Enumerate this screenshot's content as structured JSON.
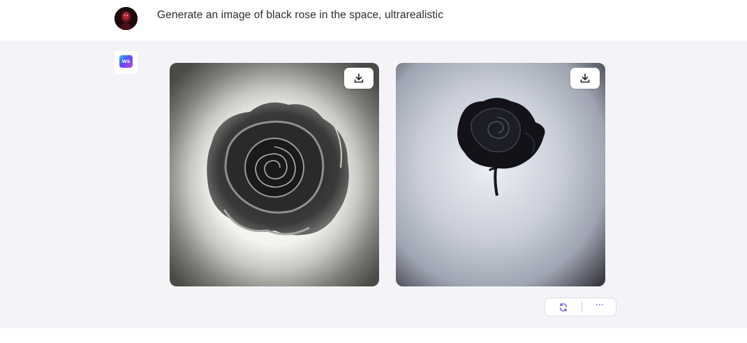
{
  "conversation": {
    "user_message": {
      "text": "Generate an image of black rose in the space, ultrarealistic",
      "avatar_icon": "user-avatar-icon"
    },
    "assistant": {
      "logo_text": "WS",
      "logo_colors": [
        "#25c4f7",
        "#5a4cf5",
        "#c341e6"
      ],
      "images": [
        {
          "subject": "black rose, bright halo background",
          "download_icon": "download-icon"
        },
        {
          "subject": "black rose with stem, gray-blue background",
          "download_icon": "download-icon"
        }
      ],
      "actions": {
        "regenerate_icon": "refresh-icon",
        "more_label": "···"
      }
    }
  },
  "colors": {
    "accent": "#6b5bd6",
    "assistant_bg": "#f4f4f8",
    "user_bg": "#ffffff"
  }
}
